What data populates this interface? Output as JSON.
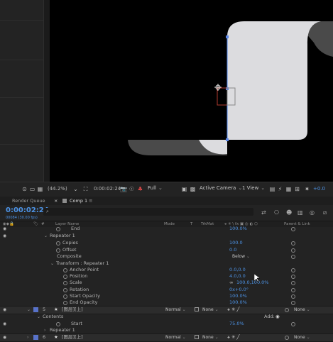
{
  "viewer": {
    "zoom": "(44.2%)",
    "time": "0:00:02:24",
    "resolution": "Full",
    "camera": "Active Camera",
    "views": "1 View",
    "exposure": "+0.0"
  },
  "tabs": {
    "render_queue": "Render Queue",
    "comp": "Comp 1"
  },
  "timeline": {
    "timecode": "0:00:02:24",
    "timecode_sub": "00084 (30.00 fps)",
    "search_placeholder": "⌕"
  },
  "columns": {
    "num": "#",
    "layer_name": "Layer Name",
    "mode": "Mode",
    "t": "T",
    "trkmat": "TrkMat",
    "parent": "Parent & Link"
  },
  "rows": [
    {
      "label": "End",
      "value": "100.0%"
    },
    {
      "label": "Repeater 1"
    },
    {
      "label": "Copies",
      "value": "100.0"
    },
    {
      "label": "Offset",
      "value": "0.0"
    },
    {
      "label": "Composite",
      "select": "Below"
    },
    {
      "label": "Transform : Repeater 1"
    },
    {
      "label": "Anchor Point",
      "value": "0.0,0.0"
    },
    {
      "label": "Position",
      "value": "4.0,0.0"
    },
    {
      "label": "Scale",
      "value": "100.0,100.0%"
    },
    {
      "label": "Rotation",
      "value": "0x+0.0°"
    },
    {
      "label": "Start Opacity",
      "value": "100.0%"
    },
    {
      "label": "End Opacity",
      "value": "100.0%"
    }
  ],
  "layer5": {
    "num": "5",
    "name": "[图层][上]",
    "mode": "Normal",
    "trkmat": "None",
    "parent": "None"
  },
  "contents": {
    "label": "Contents",
    "add": "Add:"
  },
  "start_row": {
    "label": "Start",
    "value": "75.0%"
  },
  "repeater_row": {
    "label": "Repeater 1"
  },
  "layer6": {
    "num": "6",
    "name": "[图层][上]",
    "mode": "Normal",
    "trkmat": "None",
    "parent": "None"
  },
  "colors": {
    "accent": "#4d93e6",
    "label": "#5872c9",
    "shape": "#dcdcdf",
    "shape_dark": "#4a4a4a"
  }
}
